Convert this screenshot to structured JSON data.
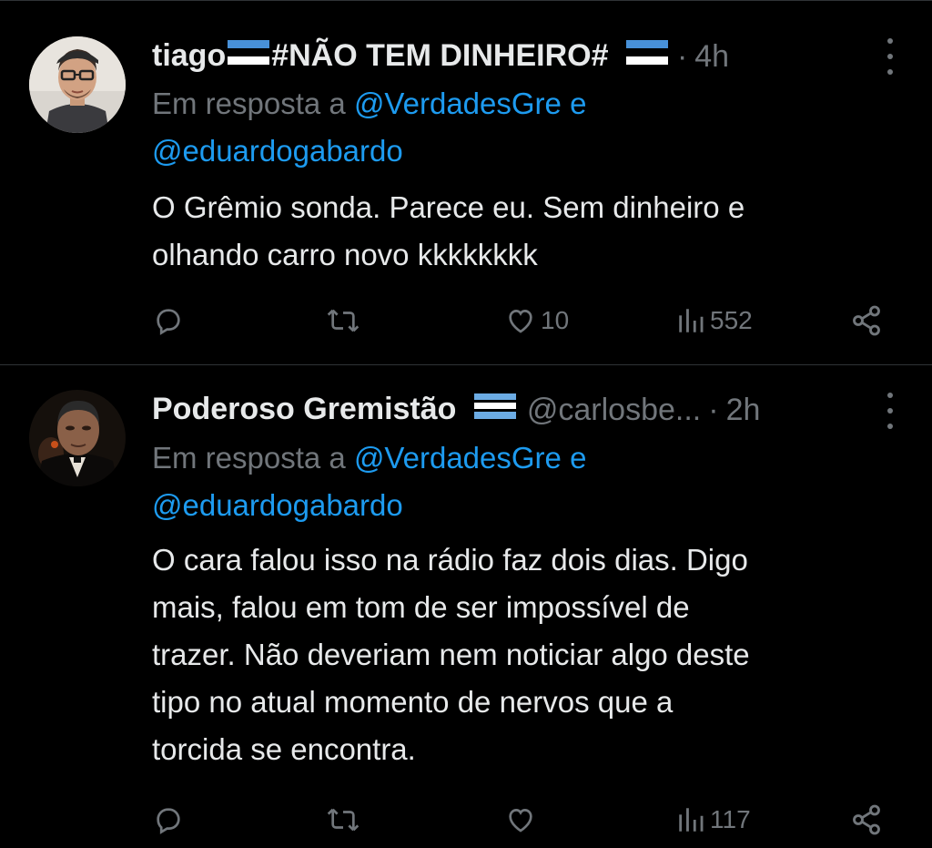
{
  "tweets": [
    {
      "name": "tiago",
      "name_rest": "#NÃO TEM DINHEIRO#",
      "handle": "",
      "time": "4h",
      "reply_prefix": "Em resposta a",
      "reply_user1": "@VerdadesGre",
      "reply_and": "e",
      "reply_user2": "@eduardogabardo",
      "text": "O Grêmio sonda. Parece eu. Sem dinheiro e\nolhando carro novo kkkkkkkk",
      "likes": "10",
      "views": "552",
      "flag_colors": [
        "#4891d9",
        "#000000",
        "#ffffff"
      ]
    },
    {
      "name": "Poderoso Gremistão",
      "handle": "@carlosbe...",
      "time": "2h",
      "reply_prefix": "Em resposta a",
      "reply_user1": "@VerdadesGre",
      "reply_and": "e",
      "reply_user2": "@eduardogabardo",
      "text": "O cara falou isso na rádio faz dois dias. Digo\nmais, falou em tom de ser impossível de\ntrazer. Não deveriam nem noticiar algo deste\ntipo no atual momento de nervos que a\ntorcida se encontra.",
      "likes": "",
      "views": "117",
      "flag_colors": [
        "#6cace4",
        "#ffffff",
        "#000000"
      ]
    }
  ],
  "icons": [
    "reply-icon",
    "retweet-icon",
    "like-icon",
    "views-icon",
    "share-icon",
    "more-icon"
  ],
  "colors": {
    "background": "#000000",
    "text": "#e7e9ea",
    "muted": "#71767b",
    "link": "#1d9bf0",
    "divider": "#2f3336"
  }
}
